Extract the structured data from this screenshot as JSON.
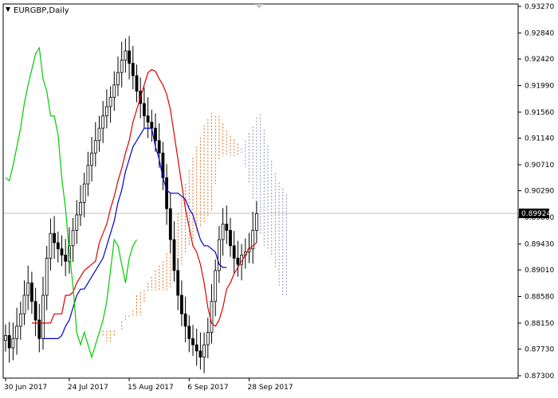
{
  "chart_data": {
    "type": "candlestick",
    "title": "EURGBP,Daily",
    "symbol": "EURGBP",
    "timeframe": "Daily",
    "ylim": [
      0.873,
      0.9327
    ],
    "y_ticks": [
      "0.93270",
      "0.92840",
      "0.92420",
      "0.91990",
      "0.91560",
      "0.91140",
      "0.90710",
      "0.90290",
      "0.89860",
      "0.89430",
      "0.89010",
      "0.88580",
      "0.88150",
      "0.87730",
      "0.87300"
    ],
    "x_ticks": [
      {
        "label": "30 Jun 2017",
        "index": 0
      },
      {
        "label": "24 Jul 2017",
        "index": 17
      },
      {
        "label": "15 Aug 2017",
        "index": 33
      },
      {
        "label": "6 Sep 2017",
        "index": 49
      },
      {
        "label": "28 Sep 2017",
        "index": 65
      }
    ],
    "last_price": "0.89924",
    "last_price_value": 0.89924,
    "colors": {
      "background": "#ffffff",
      "candle": "#000000",
      "tenkan": "#dd0000",
      "kijun": "#0000cc",
      "chikou": "#00cc00",
      "cloud_bull": "#e07020",
      "cloud_bear": "#9090c0",
      "price_line": "#c0c0c0"
    },
    "closes": [
      0.8795,
      0.8775,
      0.879,
      0.881,
      0.883,
      0.886,
      0.888,
      0.885,
      0.882,
      0.879,
      0.886,
      0.892,
      0.896,
      0.8945,
      0.8935,
      0.8925,
      0.8915,
      0.894,
      0.8965,
      0.899,
      0.901,
      0.904,
      0.907,
      0.909,
      0.911,
      0.913,
      0.915,
      0.9165,
      0.918,
      0.92,
      0.922,
      0.924,
      0.9255,
      0.9235,
      0.9215,
      0.919,
      0.917,
      0.915,
      0.914,
      0.913,
      0.911,
      0.909,
      0.905,
      0.9,
      0.895,
      0.89,
      0.886,
      0.883,
      0.881,
      0.879,
      0.878,
      0.877,
      0.876,
      0.878,
      0.88,
      0.885,
      0.89,
      0.895,
      0.8975,
      0.8965,
      0.894,
      0.892,
      0.891,
      0.8925,
      0.893,
      0.8935,
      0.8965,
      0.8992
    ],
    "tenkan": [
      0.8815,
      0.8815,
      0.8815,
      0.8815,
      0.8815,
      0.8815,
      0.883,
      0.883,
      0.883,
      0.886,
      0.886,
      0.8865,
      0.888,
      0.889,
      0.89,
      0.8905,
      0.891,
      0.8915,
      0.8945,
      0.896,
      0.8975,
      0.9,
      0.902,
      0.9045,
      0.9065,
      0.909,
      0.911,
      0.914,
      0.916,
      0.918,
      0.92,
      0.922,
      0.9225,
      0.9222,
      0.921,
      0.92,
      0.9185,
      0.916,
      0.912,
      0.908,
      0.904,
      0.9,
      0.897,
      0.894,
      0.893,
      0.891,
      0.888,
      0.884,
      0.8815,
      0.881,
      0.882,
      0.884,
      0.887,
      0.888,
      0.8895,
      0.8905,
      0.8915,
      0.8925,
      0.8935,
      0.894,
      0.8945
    ],
    "kijun": [
      0.879,
      0.879,
      0.879,
      0.879,
      0.879,
      0.8795,
      0.881,
      0.882,
      0.884,
      0.886,
      0.887,
      0.887,
      0.888,
      0.889,
      0.89,
      0.891,
      0.892,
      0.894,
      0.896,
      0.898,
      0.901,
      0.903,
      0.906,
      0.908,
      0.91,
      0.911,
      0.912,
      0.913,
      0.913,
      0.913,
      0.91,
      0.908,
      0.905,
      0.903,
      0.9025,
      0.9025,
      0.9025,
      0.902,
      0.9015,
      0.9,
      0.899,
      0.897,
      0.895,
      0.894,
      0.894,
      0.8935,
      0.893,
      0.891,
      0.8905,
      0.8905
    ],
    "chikou": [
      0.905,
      0.9045,
      0.907,
      0.91,
      0.913,
      0.917,
      0.92,
      0.9225,
      0.925,
      0.926,
      0.921,
      0.919,
      0.915,
      0.915,
      0.912,
      0.905,
      0.9,
      0.893,
      0.8875,
      0.88,
      0.878,
      0.88,
      0.878,
      0.876,
      0.878,
      0.88,
      0.882,
      0.885,
      0.89,
      0.895,
      0.894,
      0.891,
      0.888,
      0.892,
      0.894,
      0.895
    ]
  }
}
